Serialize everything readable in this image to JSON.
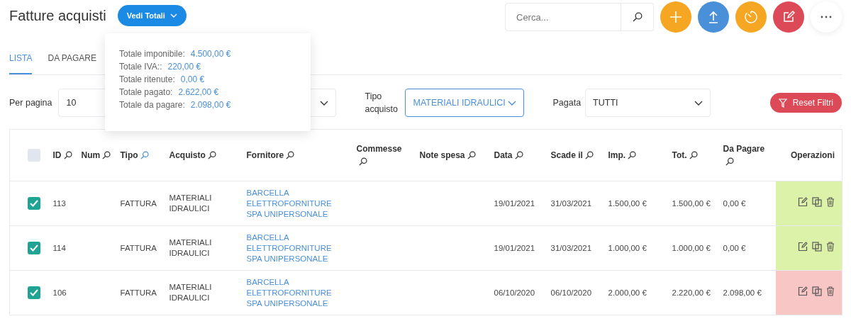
{
  "header": {
    "title": "Fatture acquisti",
    "totals_button": "Vedi Totali",
    "search": {
      "placeholder": "Cerca..."
    },
    "actions": [
      {
        "kind": "add",
        "color": "#f5a623"
      },
      {
        "kind": "upload",
        "color": "#4a90d9"
      },
      {
        "kind": "timer",
        "color": "#f5a623"
      },
      {
        "kind": "edit",
        "color": "#dc4a58"
      },
      {
        "kind": "more",
        "color": "#ffffff"
      }
    ]
  },
  "totals_popover": {
    "open": true,
    "lines": [
      {
        "label": "Totale imponibile:",
        "value": "4.500,00 €"
      },
      {
        "label": "Totale IVA::",
        "value": "220,00 €"
      },
      {
        "label": "Totale ritenute:",
        "value": "0,00 €"
      },
      {
        "label": "Totale pagato:",
        "value": "2.622,00 €"
      },
      {
        "label": "Totale da pagare:",
        "value": "2.098,00 €"
      }
    ]
  },
  "tabs": [
    {
      "label": "LISTA",
      "selected": true
    },
    {
      "label": "DA PAGARE",
      "selected": false
    }
  ],
  "filters": [
    {
      "label": "Per pagina",
      "value": "10",
      "active": false
    },
    {
      "active": false
    },
    {
      "label": "Tipo acquisto",
      "value": "MATERIALI IDRAULICI",
      "active": true
    },
    {
      "label": "Pagata",
      "value": "TUTTI",
      "active": false
    }
  ],
  "reset_button": "Reset Filtri",
  "table": {
    "select_all": {
      "checked": false
    },
    "columns": [
      {
        "label": "ID",
        "filtered": false
      },
      {
        "label": "Num",
        "filtered": false
      },
      {
        "label": "Tipo",
        "filtered": true
      },
      {
        "label": "Acquisto",
        "filtered": false
      },
      {
        "label": "Fornitore",
        "filtered": false
      },
      {
        "label": "Commesse",
        "filtered": false
      },
      {
        "label": "Note spesa",
        "filtered": false
      },
      {
        "label": "Data",
        "filtered": false
      },
      {
        "label": "Scade il",
        "filtered": false
      },
      {
        "label": "Imp.",
        "filtered": false
      },
      {
        "label": "Tot.",
        "filtered": false
      },
      {
        "label": "Da Pagare",
        "filtered": false
      }
    ],
    "operations_label": "Operazioni",
    "rows": [
      {
        "checked": true,
        "paid": true,
        "id": "113",
        "tipo": "FATTURA",
        "acquisto": "MATERIALI IDRAULICI",
        "fornitore": "BARCELLA ELETTROFORNITURE SPA UNIPERSONALE",
        "data": "19/01/2021",
        "scadenza": "31/03/2021",
        "imponibile": "1.500,00 €",
        "totale": "1.500,00 €",
        "da_pagare": "0,00 €"
      },
      {
        "checked": true,
        "paid": true,
        "id": "114",
        "tipo": "FATTURA",
        "acquisto": "MATERIALI IDRAULICI",
        "fornitore": "BARCELLA ELETTROFORNITURE SPA UNIPERSONALE",
        "data": "19/01/2021",
        "scadenza": "31/03/2021",
        "imponibile": "1.000,00 €",
        "totale": "1.000,00 €",
        "da_pagare": "0,00 €"
      },
      {
        "checked": true,
        "paid": false,
        "id": "106",
        "tipo": "FATTURA",
        "acquisto": "MATERIALI IDRAULICI",
        "fornitore": "BARCELLA ELETTROFORNITURE SPA UNIPERSONALE",
        "data": "06/10/2020",
        "scadenza": "06/10/2020",
        "imponibile": "2.000,00 €",
        "totale": "2.220,00 €",
        "da_pagare": "2.098,00 €"
      }
    ]
  }
}
